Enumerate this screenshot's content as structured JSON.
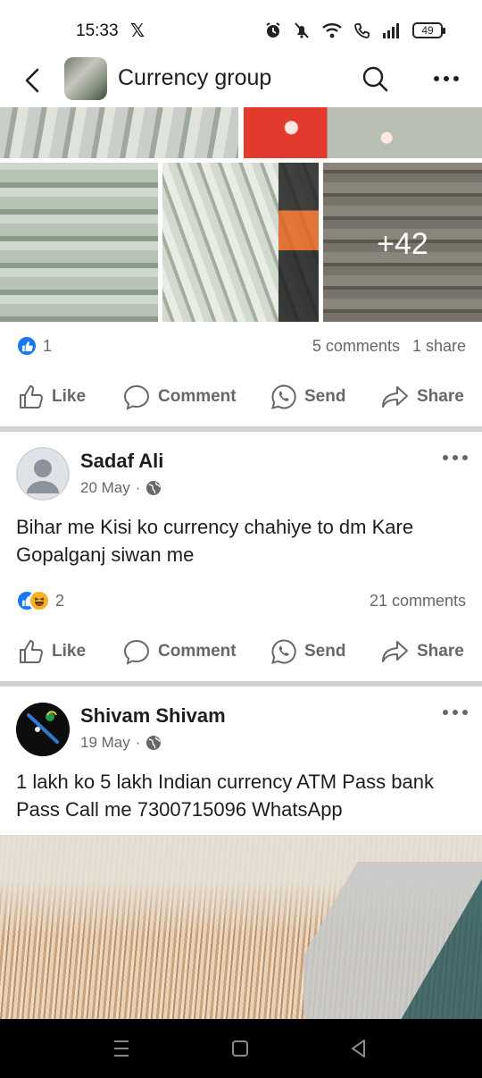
{
  "status_bar": {
    "time": "15:33",
    "notif_icon": "x-logo",
    "battery": "49"
  },
  "header": {
    "title": "Currency group",
    "back_icon": "back-arrow-icon",
    "search_icon": "search-icon",
    "more_icon": "more-icon"
  },
  "post1": {
    "more_photos": "+42",
    "reaction_count": "1",
    "comments": "5 comments",
    "shares": "1 share"
  },
  "actions": {
    "like": "Like",
    "comment": "Comment",
    "send": "Send",
    "share": "Share"
  },
  "post2": {
    "author": "Sadaf Ali",
    "date": "20 May",
    "separator": "·",
    "text": "Bihar me Kisi ko currency chahiye to dm Kare Gopalganj siwan me",
    "reaction_count": "2",
    "comments": "21 comments"
  },
  "post3": {
    "author": "Shivam Shivam",
    "date": "19 May",
    "separator": "·",
    "text": "1 lakh ko 5 lakh Indian currency ATM Pass bank Pass Call me 7300715096 WhatsApp"
  },
  "colors": {
    "brand_blue": "#1877f2",
    "text_primary": "#1c1e21",
    "text_secondary": "#65676b",
    "divider": "#ced0d4"
  }
}
